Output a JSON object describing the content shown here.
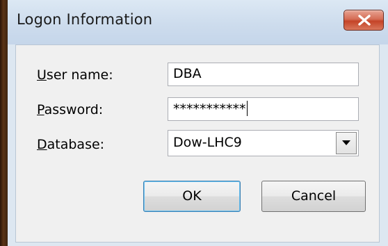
{
  "window": {
    "title": "Logon Information",
    "close_icon": "close-x-icon"
  },
  "form": {
    "username": {
      "label_mnemonic": "U",
      "label_rest": "ser name:",
      "value": "DBA"
    },
    "password": {
      "label_mnemonic": "P",
      "label_rest": "assword:",
      "value": "***********"
    },
    "database": {
      "label_mnemonic": "D",
      "label_rest": "atabase:",
      "value": "Dow-LHC9",
      "dropdown_icon": "chevron-down-icon"
    }
  },
  "buttons": {
    "ok_label": "OK",
    "cancel_label": "Cancel"
  },
  "colors": {
    "title_bar": "#cddced",
    "close_button": "#c44427",
    "client_background": "#f0f0f0",
    "default_button_border": "#3c7fb1"
  }
}
